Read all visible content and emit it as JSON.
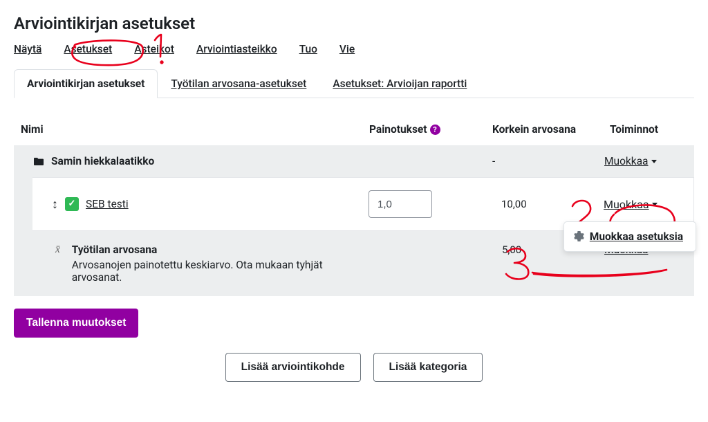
{
  "page_title": "Arviointikirjan asetukset",
  "nav": {
    "nayta": "Näytä",
    "asetukset": "Asetukset",
    "asteikot": "Asteikot",
    "arviointiasteikko": "Arviointiasteikko",
    "tuo": "Tuo",
    "vie": "Vie"
  },
  "tabs": {
    "arviointikirjan": "Arviointikirjan asetukset",
    "tyotilan": "Työtilan arvosana-asetukset",
    "asetukset_raportti": "Asetukset: Arvioijan raportti"
  },
  "headers": {
    "nimi": "Nimi",
    "painotukset": "Painotukset",
    "korkein": "Korkein arvosana",
    "toiminnot": "Toiminnot"
  },
  "category": {
    "name": "Samin hiekkalaatikko",
    "max": "-",
    "action": "Muokkaa"
  },
  "item": {
    "name": "SEB testi",
    "weight": "1,0",
    "max": "10,00",
    "action": "Muokkaa"
  },
  "dropdown": {
    "edit_settings": "Muokkaa asetuksia"
  },
  "total": {
    "label": "Työtilan arvosana",
    "sub": "Arvosanojen painotettu keskiarvo. Ota mukaan tyhjät arvosanat.",
    "max": "5,00",
    "action": "Muokkaa"
  },
  "buttons": {
    "save": "Tallenna muutokset",
    "add_item": "Lisää arviointikohde",
    "add_category": "Lisää kategoria"
  },
  "help_glyph": "?"
}
